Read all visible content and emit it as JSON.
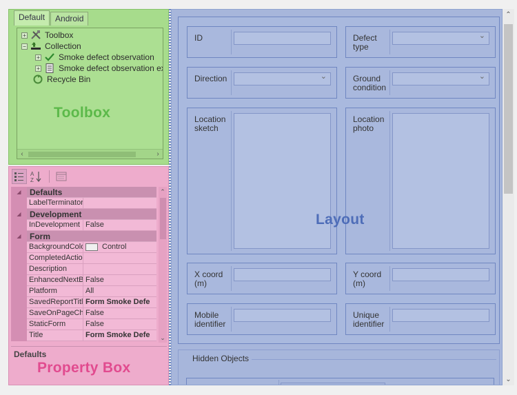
{
  "toolbox": {
    "tabs": [
      "Default",
      "Android"
    ],
    "tree": [
      {
        "expander": "+",
        "label": "Toolbox",
        "icon": "tools-icon"
      },
      {
        "expander": "−",
        "label": "Collection",
        "icon": "collection-icon"
      },
      {
        "expander": "+",
        "label": "Smoke defect observation",
        "icon": "checkmark-icon"
      },
      {
        "expander": "+",
        "label": "Smoke defect observation exte",
        "icon": "form-document-icon"
      },
      {
        "expander": "",
        "label": "Recycle Bin",
        "icon": "recycle-bin-icon"
      }
    ],
    "watermark": "Toolbox"
  },
  "property_box": {
    "rows": [
      {
        "kind": "cat",
        "name": "Defaults"
      },
      {
        "kind": "prop",
        "name": "LabelTerminator",
        "value": ""
      },
      {
        "kind": "cat",
        "name": "Development"
      },
      {
        "kind": "prop",
        "name": "InDevelopment",
        "value": "False"
      },
      {
        "kind": "cat",
        "name": "Form"
      },
      {
        "kind": "prop",
        "name": "BackgroundColo",
        "value": "Control",
        "swatch": true
      },
      {
        "kind": "prop",
        "name": "CompletedAction",
        "value": ""
      },
      {
        "kind": "prop",
        "name": "Description",
        "value": ""
      },
      {
        "kind": "prop",
        "name": "EnhancedNextB",
        "value": "False"
      },
      {
        "kind": "prop",
        "name": "Platform",
        "value": "All"
      },
      {
        "kind": "prop",
        "name": "SavedReportTitl",
        "value": "Form Smoke Defe",
        "bold": true
      },
      {
        "kind": "prop",
        "name": "SaveOnPageCha",
        "value": "False"
      },
      {
        "kind": "prop",
        "name": "StaticForm",
        "value": "False"
      },
      {
        "kind": "prop",
        "name": "Title",
        "value": "Form Smoke Defe",
        "bold": true
      }
    ],
    "description_title": "Defaults",
    "watermark": "Property Box"
  },
  "layout": {
    "fields": [
      {
        "label": "ID",
        "control": "text"
      },
      {
        "label": "Defect type",
        "control": "dropdown"
      },
      {
        "label": "Direction",
        "control": "dropdown"
      },
      {
        "label": "Ground condition",
        "control": "dropdown"
      },
      {
        "label": "Location sketch",
        "control": "image"
      },
      {
        "label": "Location photo",
        "control": "image"
      },
      {
        "label": "X coord (m)",
        "control": "text"
      },
      {
        "label": "Y coord (m)",
        "control": "text"
      },
      {
        "label": "Mobile identifier",
        "control": "text"
      },
      {
        "label": "Unique identifier",
        "control": "text"
      }
    ],
    "hidden_objects_title": "Hidden Objects",
    "watermark": "Layout"
  },
  "colors": {
    "toolbox": "#a7dc8c",
    "property_box": "#eeaccc",
    "layout": "#a7b6db"
  }
}
